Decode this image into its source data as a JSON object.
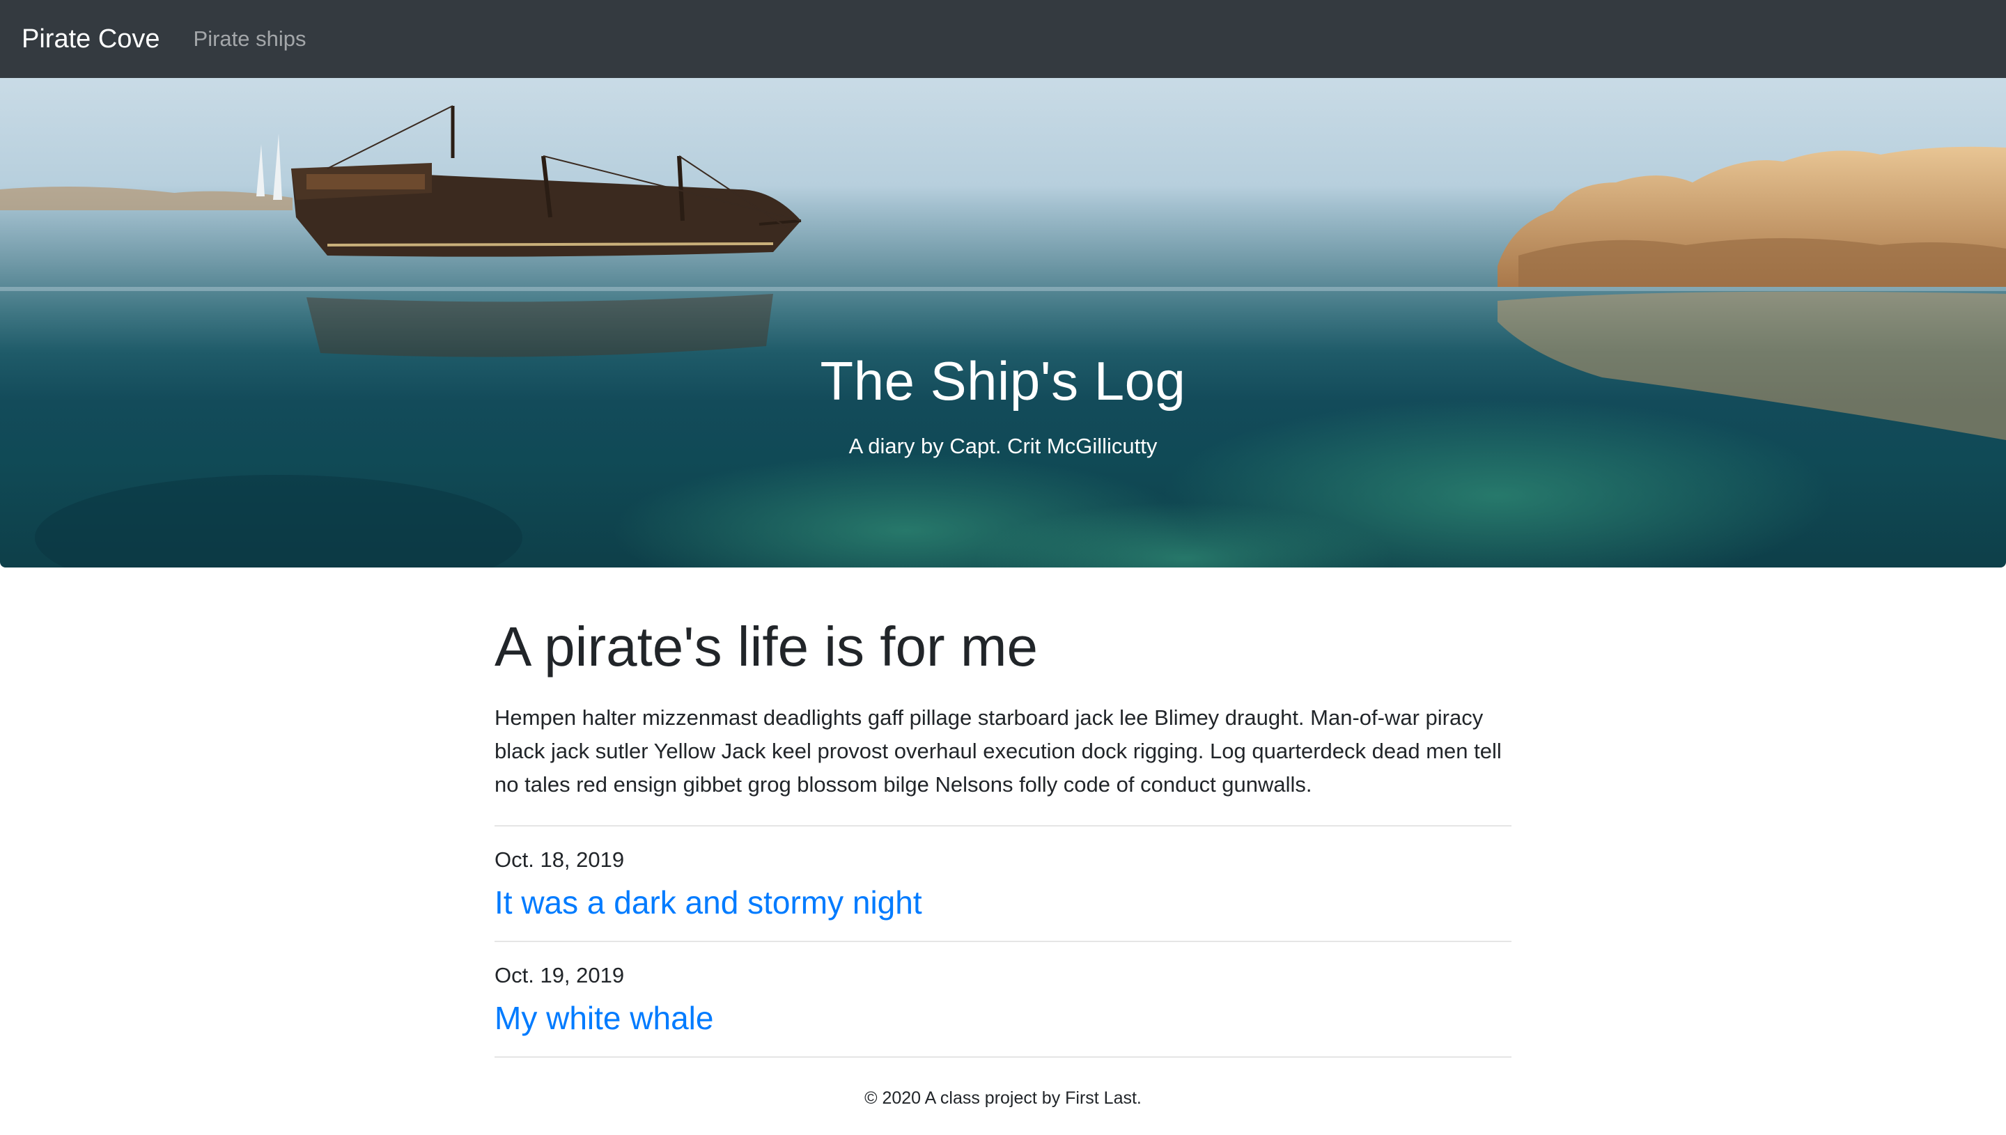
{
  "navbar": {
    "brand": "Pirate Cove",
    "links": [
      "Pirate ships"
    ]
  },
  "hero": {
    "title": "The Ship's Log",
    "subtitle": "A diary by Capt. Crit McGillicutty"
  },
  "main": {
    "heading": "A pirate's life is for me",
    "intro": "Hempen halter mizzenmast deadlights gaff pillage starboard jack lee Blimey draught. Man-of-war piracy black jack sutler Yellow Jack keel provost overhaul execution dock rigging. Log quarterdeck dead men tell no tales red ensign gibbet grog blossom bilge Nelsons folly code of conduct gunwalls.",
    "entries": [
      {
        "date": "Oct. 18, 2019",
        "title": "It was a dark and stormy night"
      },
      {
        "date": "Oct. 19, 2019",
        "title": "My white whale"
      }
    ]
  },
  "footer": {
    "text": "© 2020 A class project by First Last."
  },
  "colors": {
    "navbar_bg": "#343a40",
    "link": "#007bff",
    "text": "#212529"
  }
}
